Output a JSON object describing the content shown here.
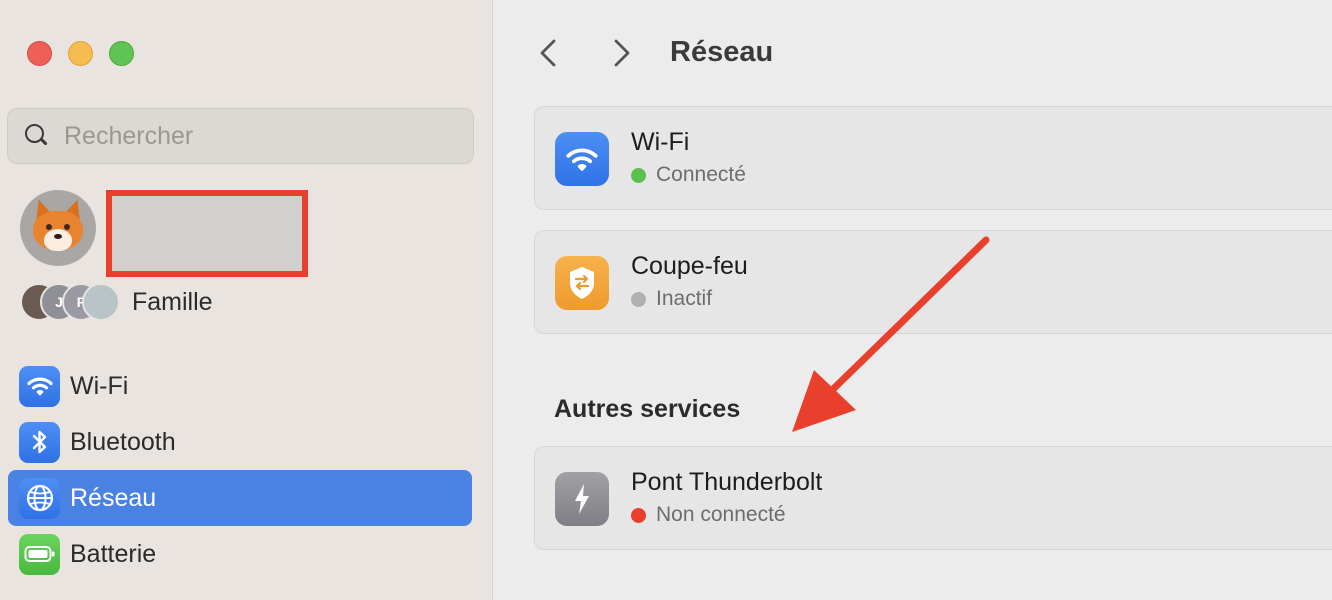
{
  "window": {
    "traffic_lights": [
      "close",
      "minimize",
      "zoom"
    ]
  },
  "sidebar": {
    "search": {
      "placeholder": "Rechercher",
      "value": ""
    },
    "account": {
      "avatar_icon": "fox-memoji-icon",
      "name_redacted": true
    },
    "family": {
      "label": "Famille",
      "member_initials": [
        "",
        "J",
        "F",
        ""
      ]
    },
    "items": [
      {
        "label": "Wi-Fi",
        "icon": "wifi-icon",
        "color": "#3b82f0",
        "selected": false
      },
      {
        "label": "Bluetooth",
        "icon": "bluetooth-icon",
        "color": "#3b82f0",
        "selected": false
      },
      {
        "label": "Réseau",
        "icon": "globe-icon",
        "color": "#3b82f0",
        "selected": true
      },
      {
        "label": "Batterie",
        "icon": "battery-icon",
        "color": "#52c148",
        "selected": false
      }
    ]
  },
  "main": {
    "title": "Réseau",
    "services": [
      {
        "name": "Wi-Fi",
        "status": "Connecté",
        "status_color": "#5ac050",
        "icon": "wifi-icon",
        "icon_color": "#3b82f0"
      },
      {
        "name": "Coupe-feu",
        "status": "Inactif",
        "status_color": "#b0b0b0",
        "icon": "firewall-shield-icon",
        "icon_color": "#f3a33a"
      }
    ],
    "other_section_title": "Autres services",
    "other_services": [
      {
        "name": "Pont Thunderbolt",
        "status": "Non connecté",
        "status_color": "#e8402d",
        "icon": "thunderbolt-icon",
        "icon_color": "#8e8e93"
      }
    ]
  },
  "annotation": {
    "arrow_color": "#e8402d",
    "highlight_color": "#e8402d"
  }
}
